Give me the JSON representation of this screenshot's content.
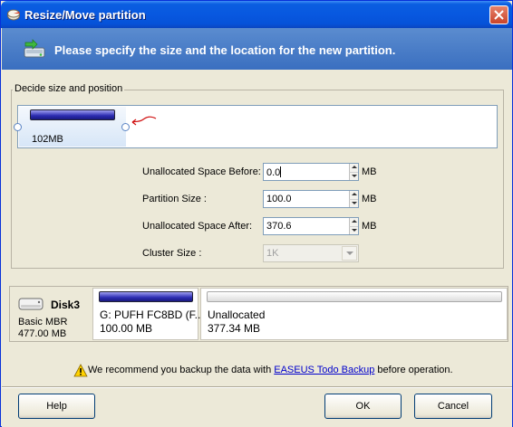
{
  "window": {
    "title": "Resize/Move partition"
  },
  "banner": {
    "text": "Please specify the size and the location for the new partition."
  },
  "group": {
    "label": "Decide size and position",
    "partition_block_size": "102MB"
  },
  "fields": {
    "before": {
      "label": "Unallocated Space Before:",
      "value": "0.0",
      "unit": "MB"
    },
    "size": {
      "label": "Partition Size :",
      "value": "100.0",
      "unit": "MB"
    },
    "after": {
      "label": "Unallocated Space After:",
      "value": "370.6",
      "unit": "MB"
    },
    "cluster": {
      "label": "Cluster Size :",
      "value": "1K"
    }
  },
  "disk": {
    "name": "Disk3",
    "type": "Basic MBR",
    "size": "477.00 MB",
    "partitions": [
      {
        "name": "G: PUFH FC8BD (F...",
        "size": "100.00 MB"
      },
      {
        "name": "Unallocated",
        "size": "377.34 MB"
      }
    ]
  },
  "warning": {
    "prefix": "We recommend you backup the data with ",
    "link": "EASEUS Todo Backup",
    "suffix": " before operation."
  },
  "buttons": {
    "help": "Help",
    "ok": "OK",
    "cancel": "Cancel"
  },
  "colors": {
    "titlebar": "#0858e0",
    "banner": "#4a7ec8",
    "partition_bar": "#2b2bb0",
    "link": "#0000cc"
  },
  "icons": {
    "title": "partition-tool-icon",
    "banner": "disk-move-icon",
    "disk": "hard-disk-icon",
    "warning": "warning-triangle-icon",
    "close": "close-icon"
  }
}
